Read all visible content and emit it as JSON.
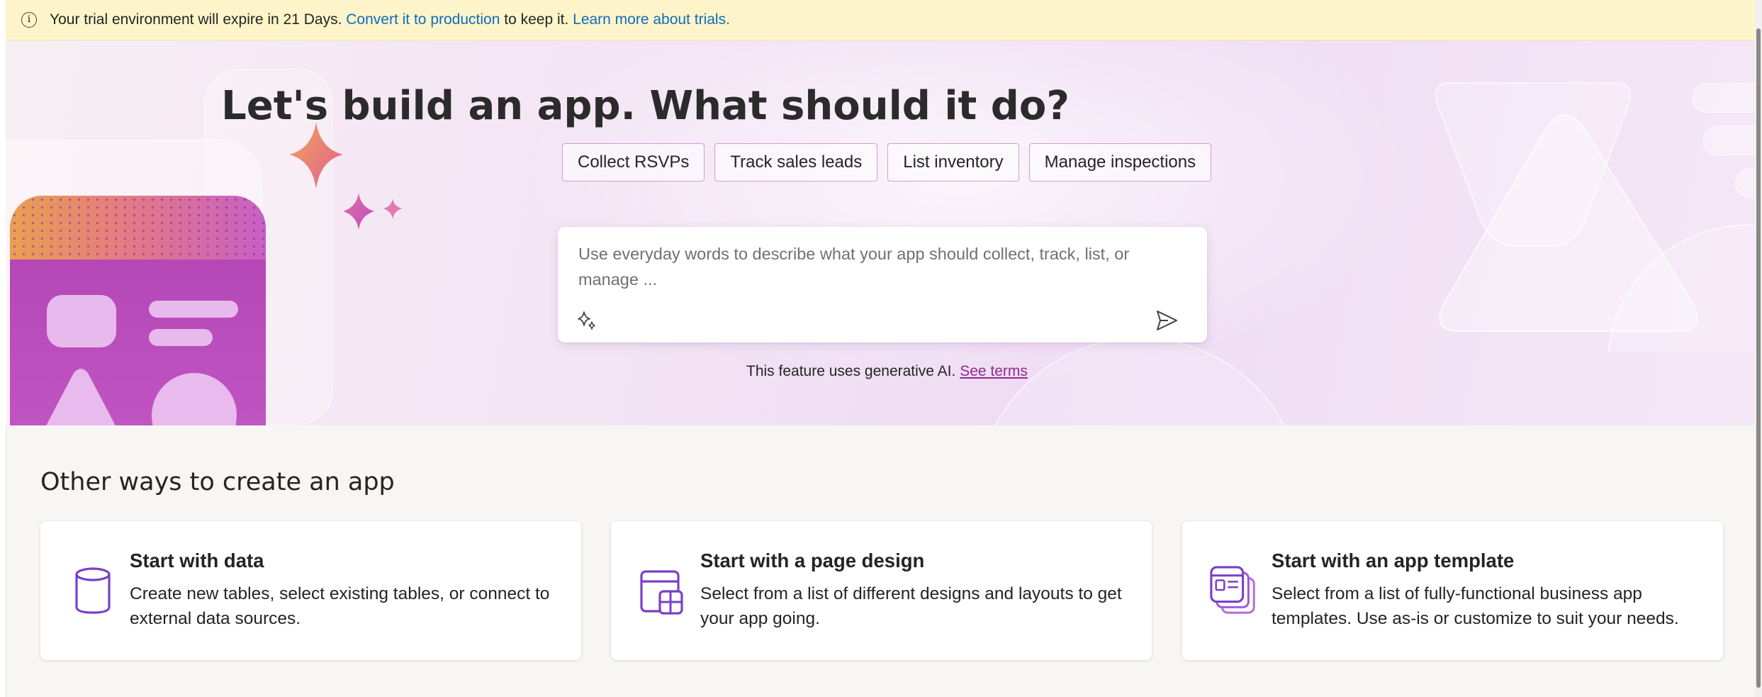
{
  "banner": {
    "icon": "info-icon",
    "text_before": "Your trial environment will expire in 21 Days.",
    "convert_link": "Convert it to production",
    "text_middle": "to keep it.",
    "learn_link": "Learn more about trials."
  },
  "hero": {
    "title": "Let's build an app. What should it do?",
    "suggestions": [
      "Collect RSVPs",
      "Track sales leads",
      "List inventory",
      "Manage inspections"
    ],
    "prompt_placeholder": "Use everyday words to describe what your app should collect, track, list, or manage ...",
    "sparkle_icon": "sparkle-icon",
    "send_icon": "send-icon",
    "ai_note": "This feature uses generative AI.",
    "terms_link": "See terms"
  },
  "other_ways": {
    "title": "Other ways to create an app",
    "cards": [
      {
        "icon": "database-icon",
        "title": "Start with data",
        "description": "Create new tables, select existing tables, or connect to external data sources."
      },
      {
        "icon": "page-design-icon",
        "title": "Start with a page design",
        "description": "Select from a list of different designs and layouts to get your app going."
      },
      {
        "icon": "app-template-icon",
        "title": "Start with an app template",
        "description": "Select from a list of fully-functional business app templates. Use as-is or customize to suit your needs."
      }
    ]
  },
  "colors": {
    "link": "#0f6cbd",
    "accent": "#8f2c8f",
    "chip_border": "#d79ad7",
    "icon_purple": "#7a3fc8",
    "banner_bg": "#fdf5c9"
  }
}
